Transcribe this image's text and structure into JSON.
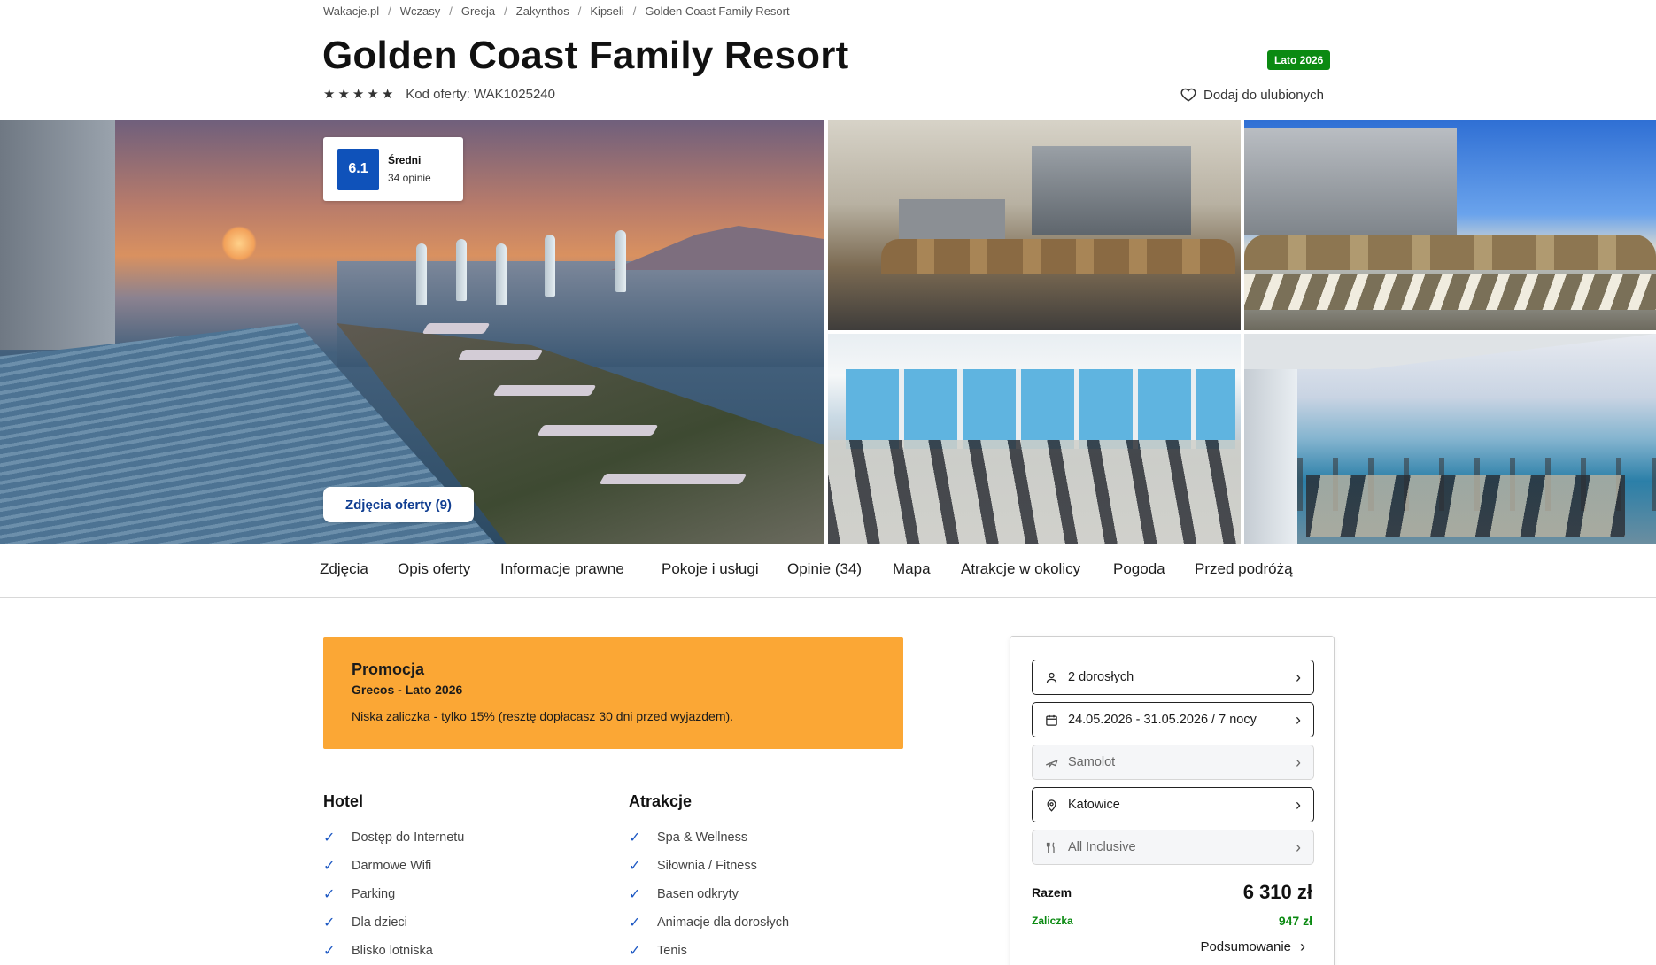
{
  "breadcrumb": [
    "Wakacje.pl",
    "Wczasy",
    "Grecja",
    "Zakynthos",
    "Kipseli",
    "Golden Coast Family Resort"
  ],
  "header": {
    "title": "Golden Coast Family Resort",
    "season_badge": "Lato 2026",
    "stars": 5,
    "star_glyph": "★",
    "offer_code": "Kod oferty: WAK1025240",
    "favorite_label": "Dodaj do ulubionych"
  },
  "rating": {
    "score": "6.1",
    "label": "Średni",
    "count": "34 opinie"
  },
  "gallery": {
    "photos_button": "Zdjęcia oferty (9)"
  },
  "tabs": [
    "Zdjęcia",
    "Opis oferty",
    "Informacje prawne",
    "Pokoje i usługi",
    "Opinie (34)",
    "Mapa",
    "Atrakcje w okolicy",
    "Pogoda",
    "Przed podróżą"
  ],
  "promo": {
    "title": "Promocja",
    "subtitle": "Grecos - Lato 2026",
    "text": "Niska zaliczka - tylko 15% (resztę dopłacasz 30 dni przed wyjazdem)."
  },
  "features": {
    "hotel": {
      "title": "Hotel",
      "items": [
        "Dostęp do Internetu",
        "Darmowe Wifi",
        "Parking",
        "Dla dzieci",
        "Blisko lotniska"
      ]
    },
    "attractions": {
      "title": "Atrakcje",
      "items": [
        "Spa & Wellness",
        "Siłownia / Fitness",
        "Basen odkryty",
        "Animacje dla dorosłych",
        "Tenis"
      ]
    }
  },
  "booking": {
    "guests": "2 dorosłych",
    "dates": "24.05.2026 - 31.05.2026 / 7 nocy",
    "transport": "Samolot",
    "departure": "Katowice",
    "board": "All Inclusive",
    "total_label": "Razem",
    "total_price": "6 310 zł",
    "deposit_label": "Zaliczka",
    "deposit_price": "947 zł",
    "summary_label": "Podsumowanie"
  },
  "colors": {
    "accent_blue": "#0f52ba",
    "promo_orange": "#fba735",
    "badge_green": "#0b8a12"
  }
}
